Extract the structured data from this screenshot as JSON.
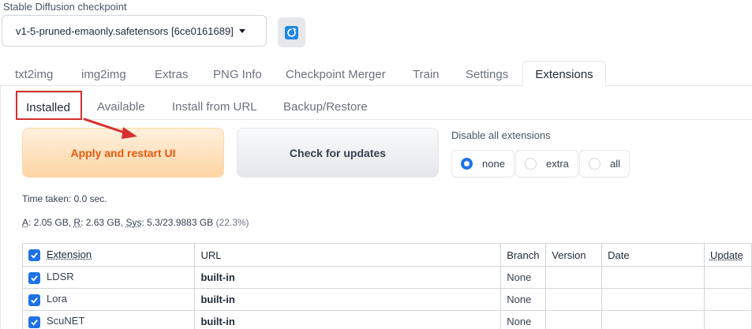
{
  "checkpoint": {
    "label": "Stable Diffusion checkpoint",
    "selected": "v1-5-pruned-emaonly.safetensors [6ce0161689]"
  },
  "main_tabs": [
    "txt2img",
    "img2img",
    "Extras",
    "PNG Info",
    "Checkpoint Merger",
    "Train",
    "Settings",
    "Extensions"
  ],
  "active_main_tab": "Extensions",
  "sub_tabs": [
    "Installed",
    "Available",
    "Install from URL",
    "Backup/Restore"
  ],
  "active_sub_tab": "Installed",
  "buttons": {
    "apply": "Apply and restart UI",
    "check": "Check for updates"
  },
  "disable": {
    "label": "Disable all extensions",
    "options": [
      "none",
      "extra",
      "all"
    ],
    "selected": "none"
  },
  "time_taken": "Time taken: 0.0 sec.",
  "memory": {
    "a_key": "A",
    "a_val": ": 2.05 GB, ",
    "r_key": "R",
    "r_val": ": 2.63 GB, ",
    "sys_key": "Sys",
    "sys_val": ": 5.3/23.9883 GB ",
    "pct": "(22.3%)"
  },
  "table": {
    "headers": [
      "Extension",
      "URL",
      "Branch",
      "Version",
      "Date",
      "Update"
    ],
    "rows": [
      {
        "name": "LDSR",
        "url": "built-in",
        "branch": "None",
        "version": "",
        "date": "",
        "update": ""
      },
      {
        "name": "Lora",
        "url": "built-in",
        "branch": "None",
        "version": "",
        "date": "",
        "update": ""
      },
      {
        "name": "ScuNET",
        "url": "built-in",
        "branch": "None",
        "version": "",
        "date": "",
        "update": ""
      }
    ]
  },
  "colors": {
    "accent": "#1d72e8",
    "apply_text": "#ea580c",
    "annotation": "#d62f2f"
  }
}
